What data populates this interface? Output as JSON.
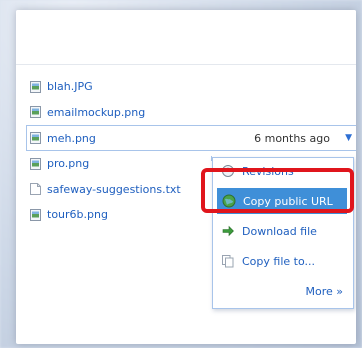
{
  "files": [
    {
      "name": "blah.JPG",
      "type": "image"
    },
    {
      "name": "emailmockup.png",
      "type": "image"
    },
    {
      "name": "meh.png",
      "type": "image",
      "modified": "6 months ago",
      "selected": true
    },
    {
      "name": "pro.png",
      "type": "image"
    },
    {
      "name": "safeway-suggestions.txt",
      "type": "text"
    },
    {
      "name": "tour6b.png",
      "type": "image"
    }
  ],
  "row_menu_arrow": "▼",
  "menu": {
    "revisions": {
      "label": "Revisions",
      "icon": "clock-icon"
    },
    "copy_public_url": {
      "label": "Copy public URL",
      "icon": "globe-icon"
    },
    "download_file": {
      "label": "Download file",
      "icon": "arrow-right-icon"
    },
    "copy_file": {
      "label": "Copy file to...",
      "icon": "copy-icon"
    },
    "more": {
      "label": "More »"
    }
  },
  "colors": {
    "link": "#1f5fbf",
    "menu_highlight": "#3f8fd8",
    "annotation_red": "#e0151c",
    "selection_border": "#a8c4ea"
  }
}
